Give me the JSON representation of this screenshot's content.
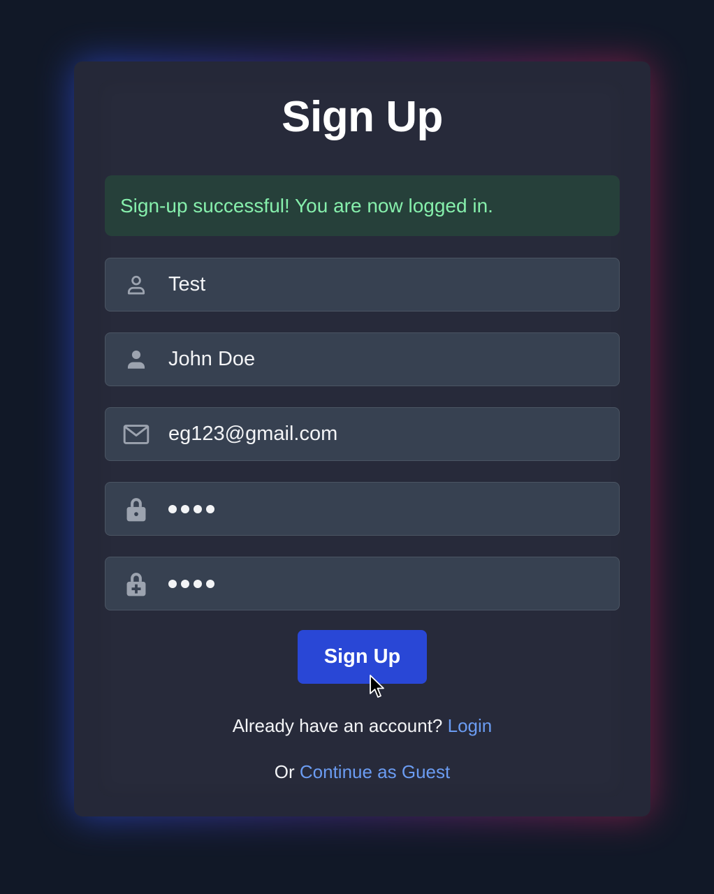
{
  "page": {
    "title": "Sign Up"
  },
  "alert": {
    "message": "Sign-up successful! You are now logged in."
  },
  "fields": {
    "username": {
      "value": "Test",
      "icon": "user-outline-icon"
    },
    "full_name": {
      "value": "John Doe",
      "icon": "user-solid-icon"
    },
    "email": {
      "value": "eg123@gmail.com",
      "icon": "envelope-icon"
    },
    "password": {
      "masked_length": 4,
      "icon": "lock-icon"
    },
    "confirm_password": {
      "masked_length": 4,
      "icon": "lock-plus-icon"
    }
  },
  "submit": {
    "label": "Sign Up"
  },
  "footer": {
    "login_prompt": "Already have an account?",
    "login_link": "Login",
    "guest_prefix": "Or",
    "guest_link": "Continue as Guest"
  },
  "colors": {
    "background": "#111827",
    "card": "#252838",
    "field": "#374151",
    "accent_button": "#2947d6",
    "success_bg": "#26403a",
    "success_text": "#86efac",
    "link": "#6b9cf2"
  }
}
